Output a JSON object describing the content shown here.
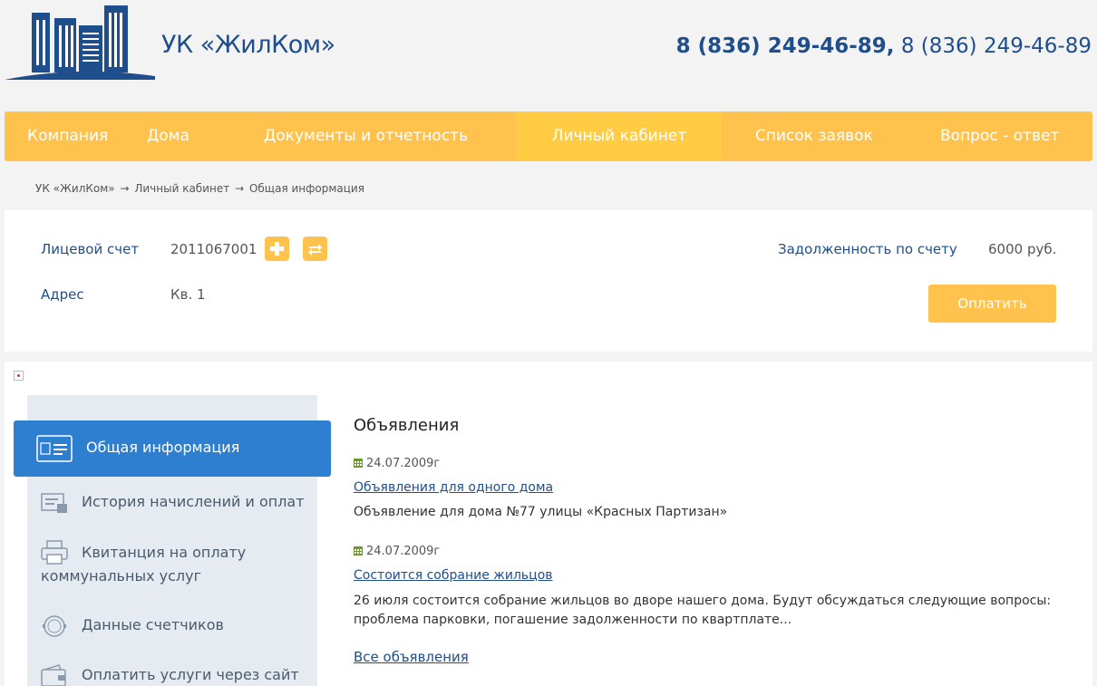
{
  "header": {
    "logo_text": "УК «ЖилКом»",
    "phone_primary": "8 (836) 249-46-89,",
    "phone_secondary": "8 (836) 249-46-89"
  },
  "nav": {
    "items": [
      "Компания",
      "Дома",
      "Документы и отчетность",
      "Личный кабинет",
      "Список заявок",
      "Вопрос - ответ"
    ],
    "active_index": 3
  },
  "breadcrumb": {
    "items": [
      "УК «ЖилКом»",
      "→",
      "Личный кабинет",
      "→",
      "Общая информация"
    ]
  },
  "account": {
    "account_label": "Лицевой счет",
    "account_number": "2011067001",
    "address_label": "Адрес",
    "address_value": "Кв. 1",
    "debt_label": "Задолженность по счету",
    "debt_value": "6000 руб.",
    "pay_button": "Оплатить"
  },
  "sidebar": {
    "items": [
      {
        "label": "Общая информация",
        "icon": "id-card-icon",
        "active": true
      },
      {
        "label": "История начислений и оплат",
        "icon": "payment-history-icon",
        "active": false
      },
      {
        "label_line1": "Квитанция на оплату",
        "label_line2": "коммунальных услуг",
        "icon": "printer-icon",
        "active": false
      },
      {
        "label": "Данные счетчиков",
        "icon": "meter-icon",
        "active": false
      },
      {
        "label": "Оплатить услуги через сайт",
        "icon": "wallet-icon",
        "active": false
      }
    ]
  },
  "content": {
    "title": "Объявления",
    "news": [
      {
        "date": "24.07.2009г",
        "title": "Объявления для одного дома",
        "text": "Объявление для дома №77 улицы «Красных Партизан»"
      },
      {
        "date": "24.07.2009г",
        "title": "Состоится собрание жильцов",
        "text": "26 июля состоится собрание жильцов во дворе нашего дома. Будут обсуждаться следующие вопросы: проблема парковки, погашение задолженности по квартплате..."
      }
    ],
    "all_link": "Все объявления"
  },
  "colors": {
    "brand_blue": "#1f4e8c",
    "accent_orange": "#ffc34d",
    "active_blue": "#2f7fd0"
  }
}
